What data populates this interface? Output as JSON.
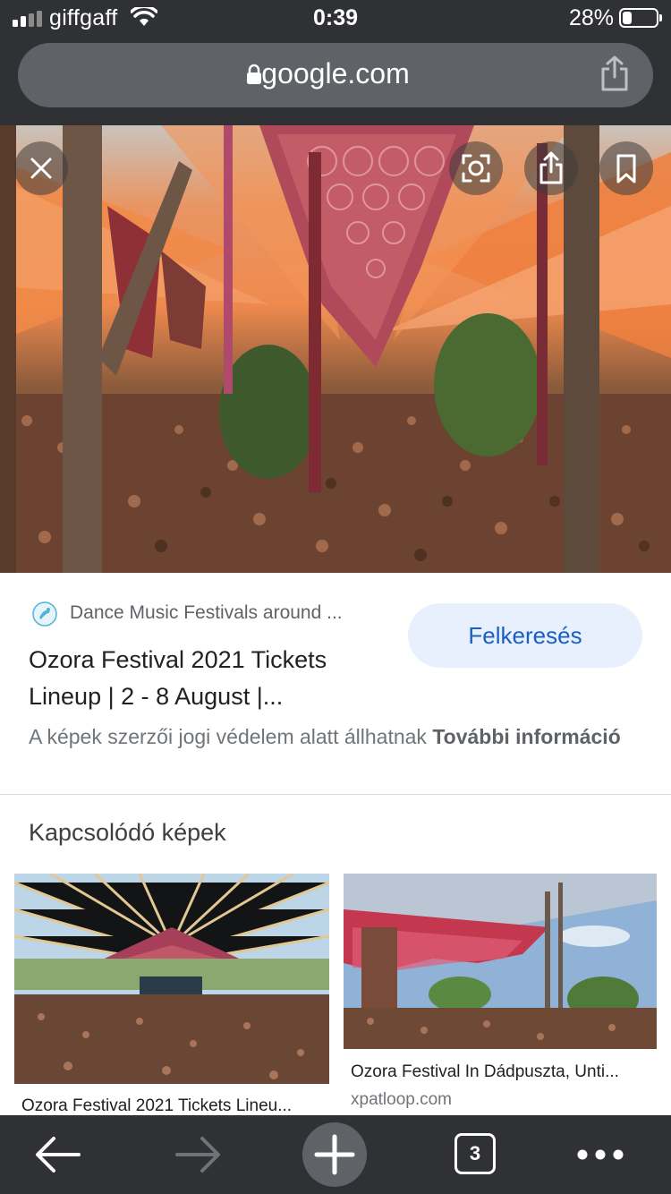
{
  "status_bar": {
    "carrier": "giffgaff",
    "time": "0:39",
    "battery_percent": "28%",
    "battery_level": 0.28
  },
  "address_bar": {
    "url": "google.com"
  },
  "image_viewer": {
    "close_label": "close",
    "lens_label": "lens",
    "share_label": "share",
    "save_label": "bookmark"
  },
  "result": {
    "source_name": "Dance Music Festivals around ...",
    "visit_button": "Felkeresés",
    "title_line1": "Ozora Festival 2021 Tickets",
    "title_line2": "Lineup | 2 - 8 August |...",
    "copyright_text": "A képek szerzői jogi védelem alatt állhatnak",
    "copyright_link": "További információ"
  },
  "related": {
    "heading": "Kapcsolódó képek",
    "items": [
      {
        "caption": "Ozora Festival 2021 Tickets Lineu...",
        "domain": ""
      },
      {
        "caption": "Ozora Festival In Dádpuszta, Unti...",
        "domain": "xpatloop.com"
      }
    ]
  },
  "toolbar": {
    "tab_count": "3"
  },
  "colors": {
    "chrome_bg": "#303134",
    "url_bar_bg": "#5f6368",
    "accent_blue": "#1a5fc1",
    "visit_button_bg": "#e8f0fe"
  }
}
